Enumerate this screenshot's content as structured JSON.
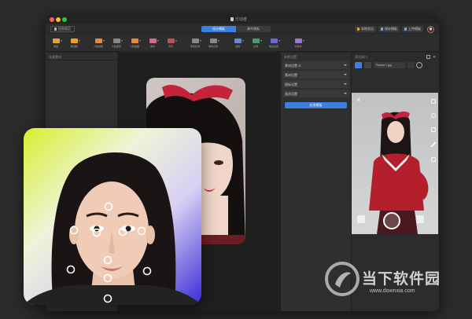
{
  "window": {
    "title": "乐动者",
    "traffic_colors": [
      "#ff5f57",
      "#febc2e",
      "#28c840"
    ]
  },
  "topbar": {
    "back_button": "回到首页",
    "tabs": [
      {
        "label": "设计模板",
        "active": true
      },
      {
        "label": "事件模板",
        "active": false
      }
    ],
    "right_buttons": [
      "本地导出",
      "保存模板",
      "上传模板"
    ]
  },
  "toolbar": {
    "tools": [
      "添加",
      "导出图",
      "人脸替换",
      "人脸变形",
      "人脸贴图",
      "素材",
      "背景",
      "形象检测",
      "重新识别",
      "滤镜",
      "比例",
      "输出设置",
      "文件夹"
    ]
  },
  "left_panel": {
    "header": "场景素材"
  },
  "mid_panel": {
    "header": "参数设置",
    "sections": [
      "素材设置 ①",
      "素材设置",
      "图标设置",
      "画质设置"
    ],
    "apply_button": "应用模板"
  },
  "right_panel": {
    "header": "预览窗口",
    "model_select": "Person 1.jpg"
  },
  "watermark": {
    "brand": "当下软件园",
    "url": "www.downxia.com"
  }
}
